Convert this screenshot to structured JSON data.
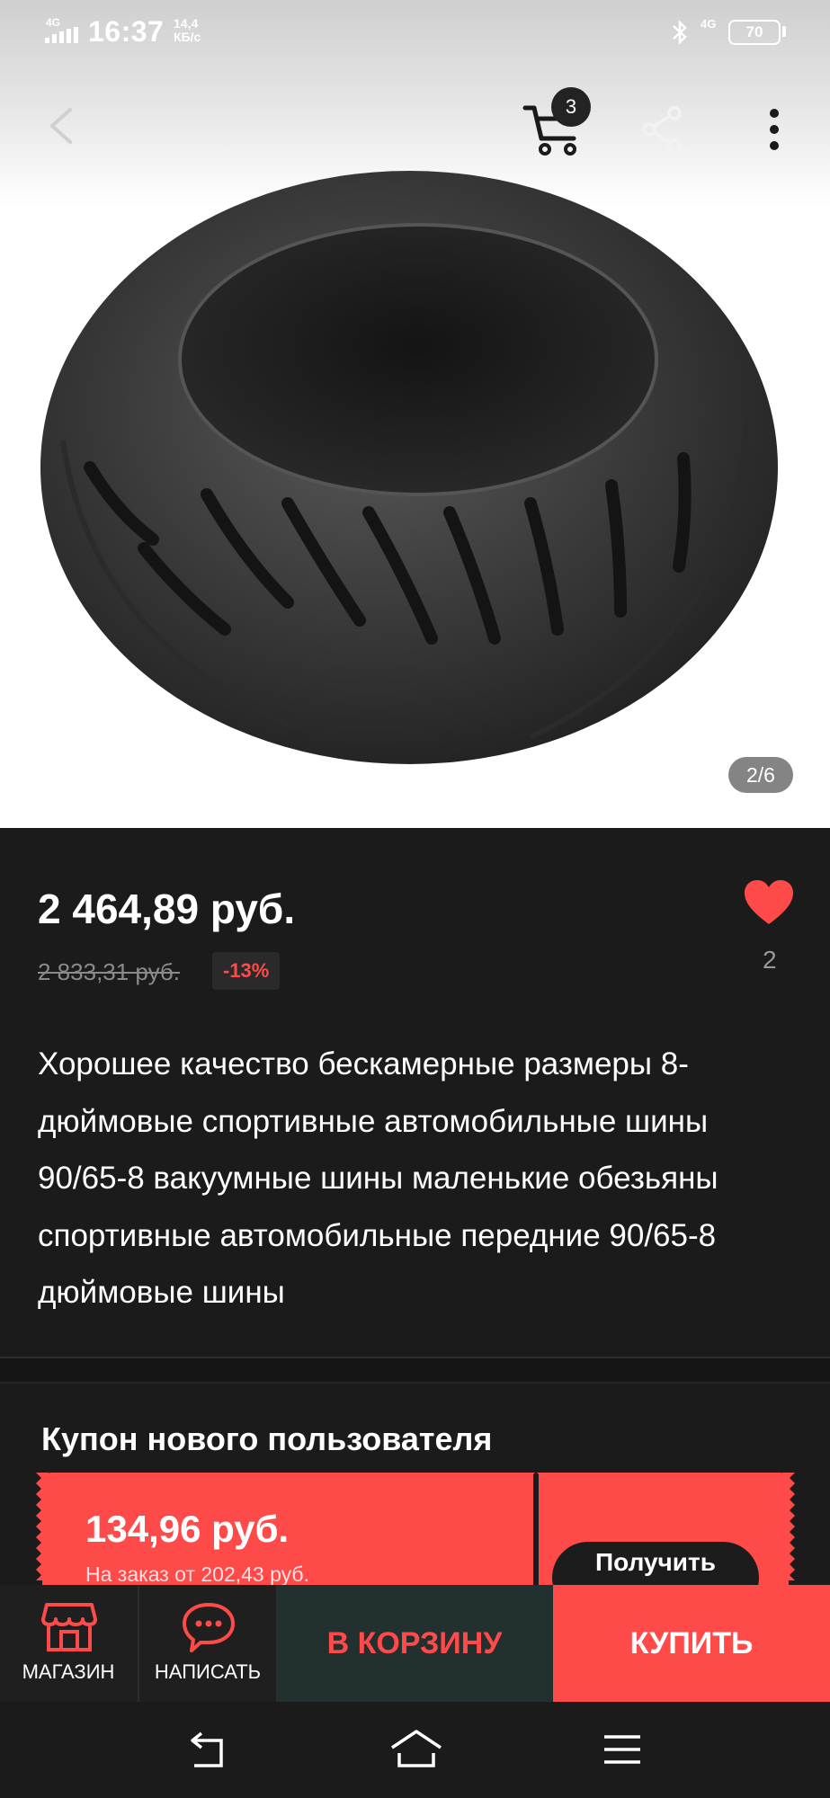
{
  "status_bar": {
    "network": "4G",
    "time": "16:37",
    "speed_value": "14,4",
    "speed_unit": "КБ/с",
    "network_right": "4G",
    "battery": "70"
  },
  "topbar": {
    "cart_count": "3",
    "icons": [
      "back-icon",
      "cart-icon",
      "share-icon",
      "more-icon"
    ]
  },
  "gallery": {
    "counter": "2/6"
  },
  "product": {
    "price": "2 464,89 руб.",
    "old_price": "2 833,31 руб.",
    "discount": "-13%",
    "favorites_count": "2",
    "title": "Хорошее качество бескамерные размеры 8-дюймовые спортивные автомобильные шины 90/65-8 вакуумные шины маленькие обезьяны спортивные автомобильные передние 90/65-8 дюймовые шины"
  },
  "coupon": {
    "heading": "Купон нового пользователя",
    "amount": "134,96 руб.",
    "min_order": "На заказ от 202,43 руб.",
    "get_label": "Получить"
  },
  "actions": {
    "shop_label": "МАГАЗИН",
    "message_label": "НАПИСАТЬ",
    "add_to_cart_label": "В КОРЗИНУ",
    "buy_label": "КУПИТЬ"
  },
  "colors": {
    "accent": "#ff4a4a",
    "background": "#1b1b1b",
    "cart_button_bg": "#233030"
  }
}
